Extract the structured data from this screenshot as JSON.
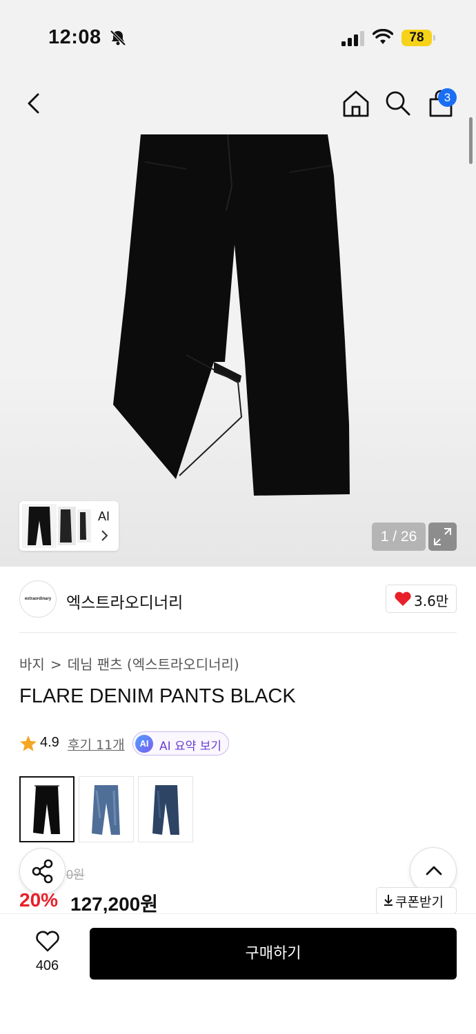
{
  "status_bar": {
    "time": "12:08",
    "battery": "78"
  },
  "nav": {
    "cart_count": "3"
  },
  "gallery": {
    "page_indicator": "1 / 26",
    "thumb_strip_label": "AI"
  },
  "brand": {
    "name": "엑스트라오디너리",
    "logo_text": "extraordinary",
    "likes": "3.6만"
  },
  "breadcrumb": {
    "category": "바지",
    "subcategory": "데님 팬츠 (엑스트라오디너리)"
  },
  "product": {
    "title": "FLARE DENIM PANTS BLACK"
  },
  "rating": {
    "score": "4.9",
    "reviews_label": "후기 11개",
    "ai_badge": "AI",
    "ai_summary_label": "AI 요약 보기"
  },
  "color_options": [
    {
      "name": "black",
      "selected": true
    },
    {
      "name": "mid-blue",
      "selected": false
    },
    {
      "name": "dark-blue",
      "selected": false
    }
  ],
  "price": {
    "original": "0원",
    "discount": "20%",
    "sale": "127,200원",
    "coupon_label": "쿠폰받기"
  },
  "bottom_bar": {
    "wish_count": "406",
    "buy_label": "구매하기"
  },
  "colors": {
    "accent_red": "#e8202a",
    "badge_blue": "#1a6ef5",
    "heart_red": "#e8202a",
    "star": "#f5a623",
    "battery": "#f7d21a"
  }
}
